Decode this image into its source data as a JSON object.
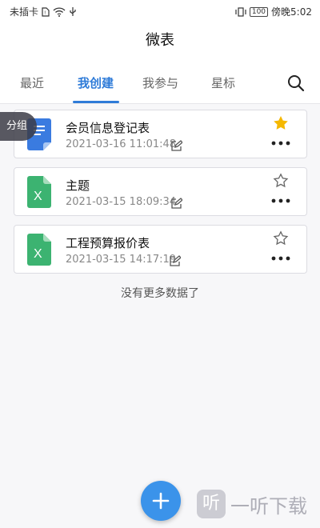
{
  "status_bar": {
    "carrier": "未插卡",
    "battery": "100",
    "time": "傍晚5:02"
  },
  "header": {
    "title": "微表"
  },
  "tabs": [
    {
      "label": "最近",
      "active": false
    },
    {
      "label": "我创建",
      "active": true
    },
    {
      "label": "我参与",
      "active": false
    },
    {
      "label": "星标",
      "active": false
    }
  ],
  "group_tab": {
    "label": "分组"
  },
  "files": [
    {
      "name": "会员信息登记表",
      "time": "2021-03-16 11:01:48",
      "type": "form-icon",
      "starred": true
    },
    {
      "name": "主题",
      "time": "2021-03-15 18:09:34",
      "type": "excel-icon",
      "starred": false
    },
    {
      "name": "工程预算报价表",
      "time": "2021-03-15 14:17:19",
      "type": "excel-icon",
      "starred": false
    }
  ],
  "footer_note": "没有更多数据了",
  "watermark": {
    "logo": "听",
    "text": "一听下载"
  },
  "colors": {
    "accent": "#2e7bd8",
    "fab": "#3b93ea",
    "excel": "#3cb371",
    "form": "#3a7be0",
    "star": "#f5b800"
  }
}
